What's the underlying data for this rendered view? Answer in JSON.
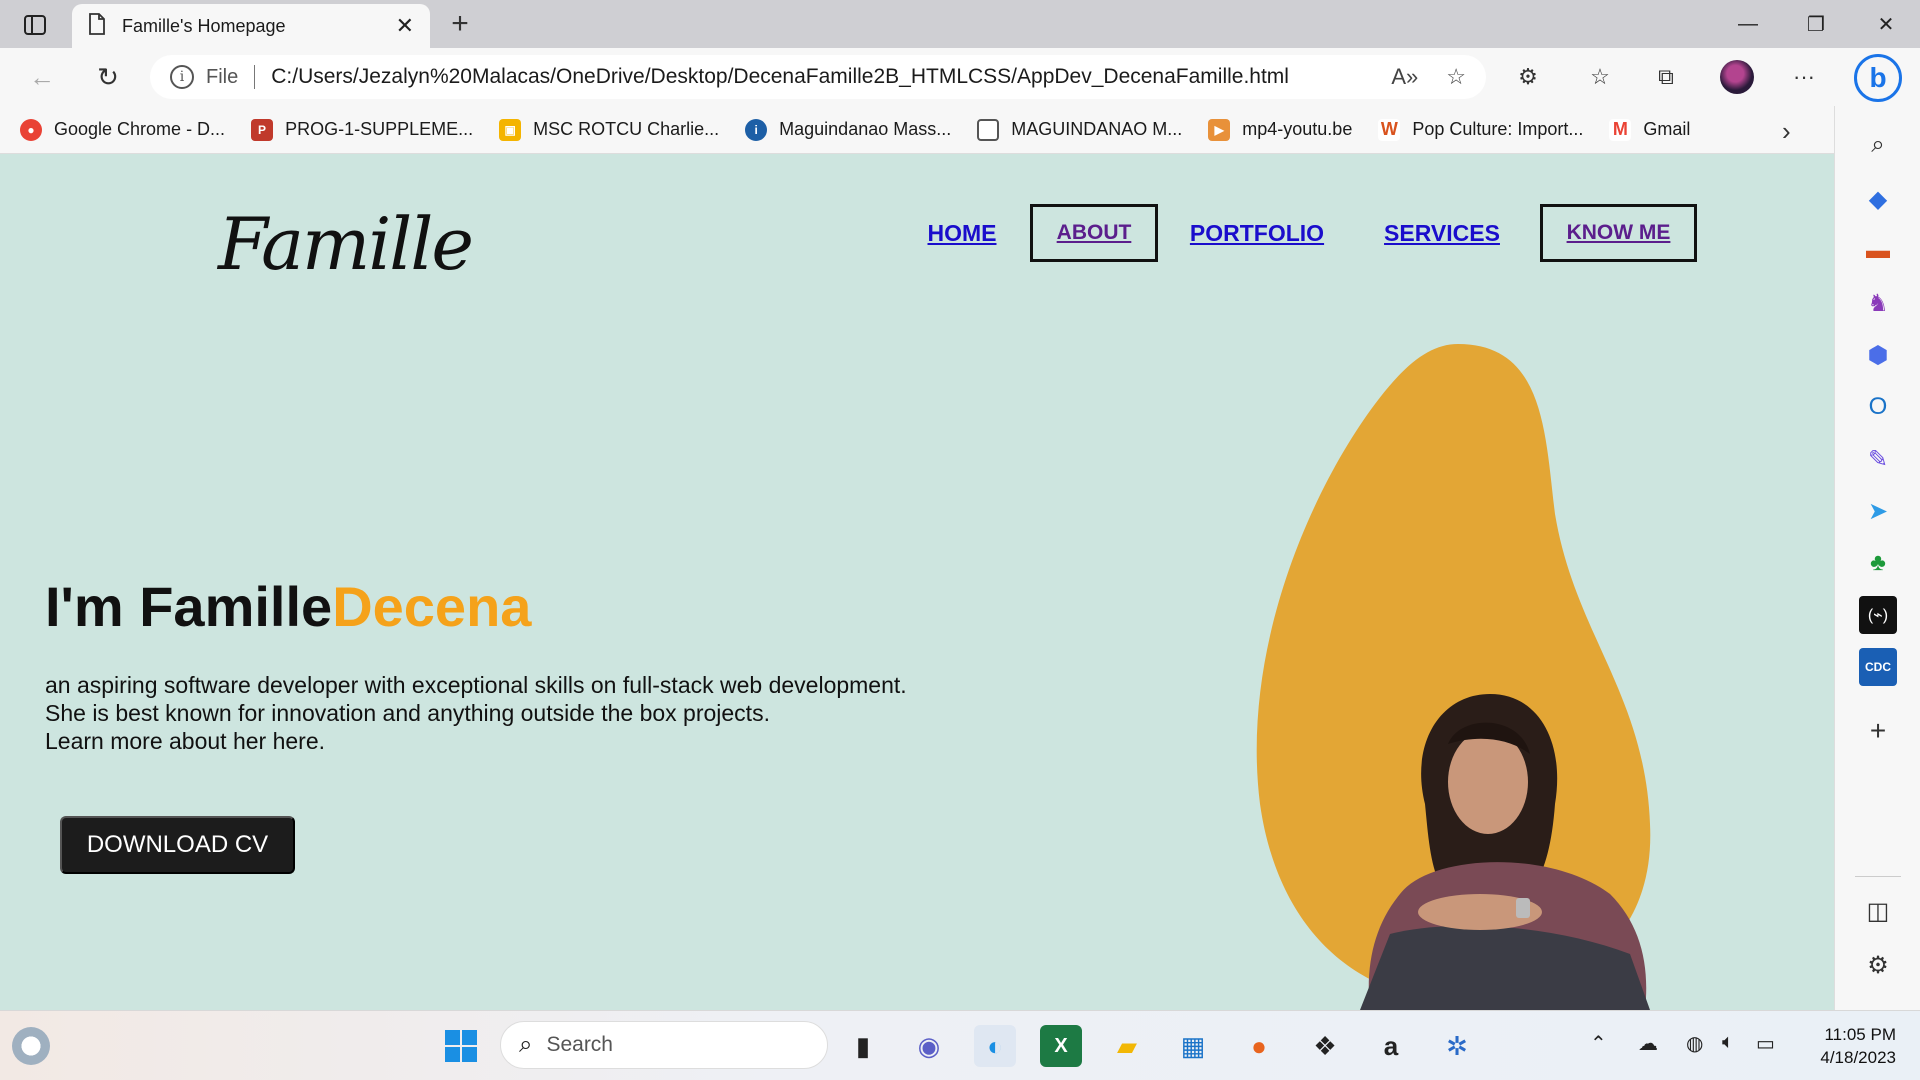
{
  "browser": {
    "tab_title": "Famille's Homepage",
    "url_scheme": "File",
    "url": "C:/Users/Jezalyn%20Malacas/OneDrive/Desktop/DecenaFamille2B_HTMLCSS/AppDev_DecenaFamille.html",
    "bookmarks": [
      {
        "label": "Google Chrome - D...",
        "icon": "chrome-icon",
        "color": "#e94235"
      },
      {
        "label": "PROG-1-SUPPLEME...",
        "icon": "pdf-icon",
        "color": "#c0392b"
      },
      {
        "label": "MSC ROTCU Charlie...",
        "icon": "classroom-icon",
        "color": "#f4b400"
      },
      {
        "label": "Maguindanao Mass...",
        "icon": "inquirer-icon",
        "color": "#1d5fa6"
      },
      {
        "label": "MAGUINDANAO M...",
        "icon": "document-icon",
        "color": "#777777"
      },
      {
        "label": "mp4-youtu.be",
        "icon": "video-icon",
        "color": "#e8913a"
      },
      {
        "label": "Pop Culture: Import...",
        "icon": "w-icon",
        "color": "#d9531e"
      },
      {
        "label": "Gmail",
        "icon": "gmail-icon",
        "color": "#ea4335"
      }
    ]
  },
  "page": {
    "logo": "Famille",
    "nav": {
      "home": "HOME",
      "about": "ABOUT",
      "portfolio": "PORTFOLIO",
      "services": "SERVICES",
      "know_me": "KNOW ME"
    },
    "hero": {
      "title_prefix": "I'm Famille",
      "title_accent": "Decena",
      "lines": [
        "an aspiring software developer with exceptional skills on full-stack web development.",
        "She is best known for innovation and anything outside the box projects.",
        "Learn more about her here."
      ],
      "cta": "DOWNLOAD CV"
    },
    "colors": {
      "background": "#cde5df",
      "accent": "#f5a21a",
      "blob": "#e3a635",
      "button": "#1c1c1c"
    }
  },
  "taskbar": {
    "search_placeholder": "Search",
    "time": "11:05 PM",
    "date": "4/18/2023"
  }
}
